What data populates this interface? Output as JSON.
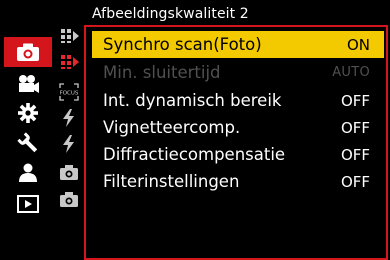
{
  "header": {
    "title": "Afbeeldingskwaliteit 2"
  },
  "rail": {
    "items": [
      {
        "name": "photo-mode-icon",
        "active": true
      },
      {
        "name": "video-mode-icon",
        "active": false
      },
      {
        "name": "custom-settings-icon",
        "active": false
      },
      {
        "name": "setup-wrench-icon",
        "active": false
      },
      {
        "name": "my-menu-person-icon",
        "active": false
      },
      {
        "name": "playback-icon",
        "active": false
      }
    ]
  },
  "subtabs": {
    "items": [
      {
        "name": "image-quality-1-icon"
      },
      {
        "name": "image-quality-2-icon",
        "active": true
      },
      {
        "name": "focus-icon",
        "label": "FOCUS"
      },
      {
        "name": "flash-icon"
      },
      {
        "name": "flash-2-icon"
      },
      {
        "name": "camera-others-1-icon"
      },
      {
        "name": "camera-others-2-icon"
      }
    ]
  },
  "menu": {
    "items": [
      {
        "label": "Synchro scan(Foto)",
        "value": "ON",
        "state": "selected"
      },
      {
        "label": "Min. sluitertijd",
        "value": "AUTO",
        "state": "disabled"
      },
      {
        "label": "Int. dynamisch bereik",
        "value": "OFF",
        "state": "normal"
      },
      {
        "label": "Vignetteercomp.",
        "value": "OFF",
        "state": "normal"
      },
      {
        "label": "Diffractiecompensatie",
        "value": "OFF",
        "state": "normal"
      },
      {
        "label": "Filterinstellingen",
        "value": "OFF",
        "state": "normal"
      }
    ]
  },
  "colors": {
    "accent": "#d4151b",
    "highlight": "#f3c900",
    "disabled": "#505050"
  }
}
